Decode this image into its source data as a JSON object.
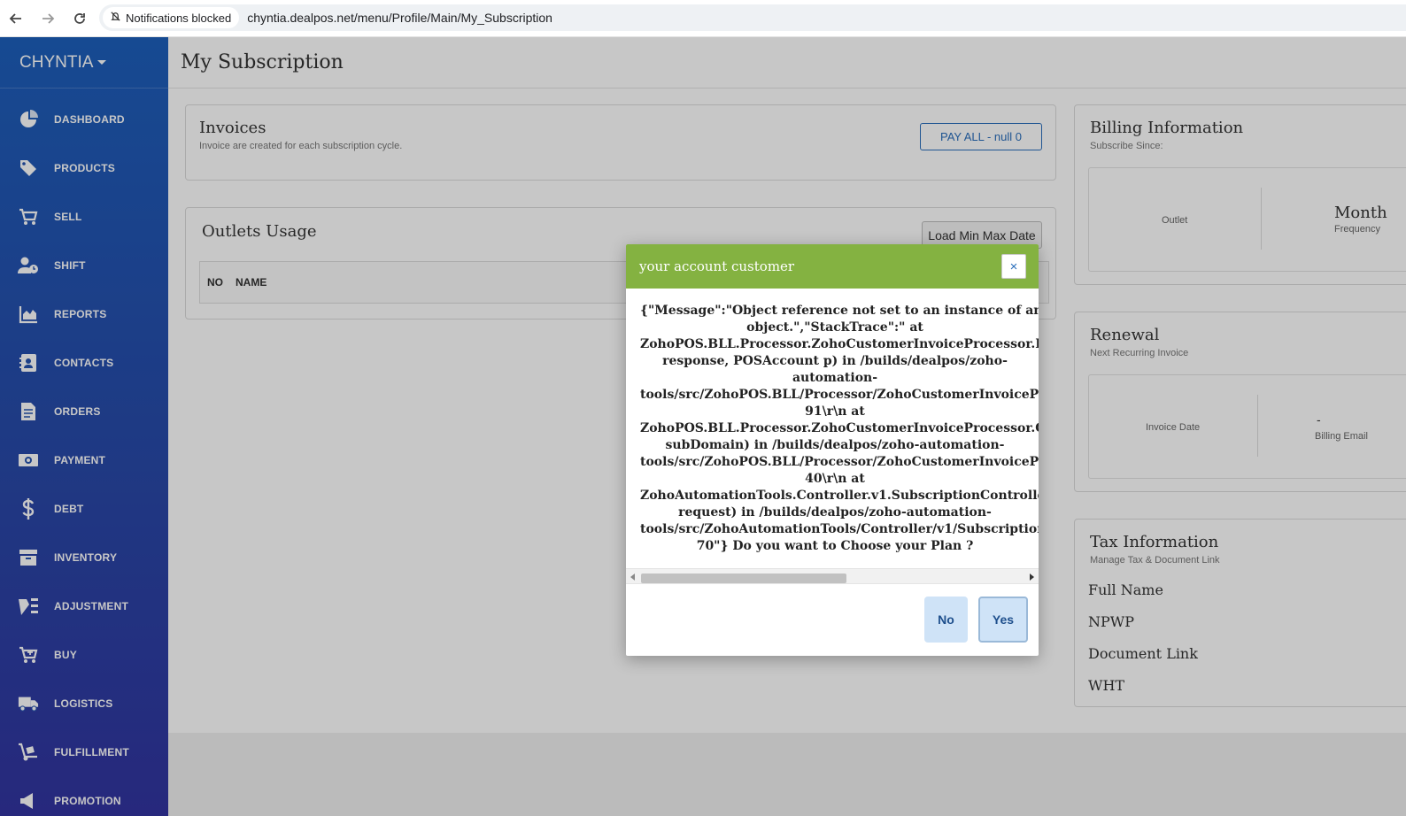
{
  "browser": {
    "notification_chip": "Notifications blocked",
    "url": "chyntia.dealpos.net/menu/Profile/Main/My_Subscription"
  },
  "sidebar": {
    "brand": "CHYNTIA",
    "items": [
      {
        "label": "DASHBOARD",
        "icon": "pie-chart-icon"
      },
      {
        "label": "PRODUCTS",
        "icon": "tag-icon"
      },
      {
        "label": "SELL",
        "icon": "cart-icon"
      },
      {
        "label": "SHIFT",
        "icon": "user-clock-icon"
      },
      {
        "label": "REPORTS",
        "icon": "area-chart-icon"
      },
      {
        "label": "CONTACTS",
        "icon": "address-card-icon"
      },
      {
        "label": "ORDERS",
        "icon": "document-icon"
      },
      {
        "label": "PAYMENT",
        "icon": "money-icon"
      },
      {
        "label": "DEBT",
        "icon": "dollar-icon"
      },
      {
        "label": "INVENTORY",
        "icon": "archive-icon"
      },
      {
        "label": "ADJUSTMENT",
        "icon": "adjustment-icon"
      },
      {
        "label": "BUY",
        "icon": "cart-plus-icon"
      },
      {
        "label": "LOGISTICS",
        "icon": "truck-icon"
      },
      {
        "label": "FULFILLMENT",
        "icon": "dolly-icon"
      },
      {
        "label": "PROMOTION",
        "icon": "megaphone-icon"
      }
    ]
  },
  "page": {
    "title": "My Subscription"
  },
  "invoices": {
    "title": "Invoices",
    "subtitle": "Invoice are created for each subscription cycle.",
    "pay_all_button": "PAY ALL - null 0"
  },
  "outlets": {
    "title": "Outlets Usage",
    "load_button": "Load Min Max Date",
    "columns": [
      "NO",
      "NAME"
    ]
  },
  "billing": {
    "title": "Billing Information",
    "subtitle": "Subscribe Since:",
    "outlet_label": "Outlet",
    "frequency_value": "Month",
    "frequency_label": "Frequency"
  },
  "renewal": {
    "title": "Renewal",
    "subtitle": "Next Recurring Invoice",
    "invoice_date_label": "Invoice Date",
    "billing_email_value": "-",
    "billing_email_label": "Billing Email"
  },
  "tax": {
    "title": "Tax Information",
    "subtitle": "Manage Tax & Document Link",
    "fields": [
      "Full Name",
      "NPWP",
      "Document Link",
      "WHT"
    ]
  },
  "modal": {
    "title": "your account customer",
    "close_symbol": "×",
    "message": "{\"Message\":\"Object reference not set to an instance of an\nobject.\",\"StackTrace\":\" at\nZohoPOS.BLL.Processor.ZohoCustomerInvoiceProcessor.HandleZohoResponse(ZohoResponse\nresponse, POSAccount p) in /builds/dealpos/zoho-\nautomation-\ntools/src/ZohoPOS.BLL/Processor/ZohoCustomerInvoiceProcessor.cs:line\n91\\r\\n at\nZohoPOS.BLL.Processor.ZohoCustomerInvoiceProcessor.GetInvoice(String\nsubDomain) in /builds/dealpos/zoho-automation-\ntools/src/ZohoPOS.BLL/Processor/ZohoCustomerInvoiceProcessor.cs:line\n40\\r\\n at\nZohoAutomationTools.Controller.v1.SubscriptionController.GetInvoice(Request\nrequest) in /builds/dealpos/zoho-automation-\ntools/src/ZohoAutomationTools/Controller/v1/SubscriptionController.cs:line\n70\"} Do you want to Choose your Plan ?",
    "no_button": "No",
    "yes_button": "Yes"
  }
}
